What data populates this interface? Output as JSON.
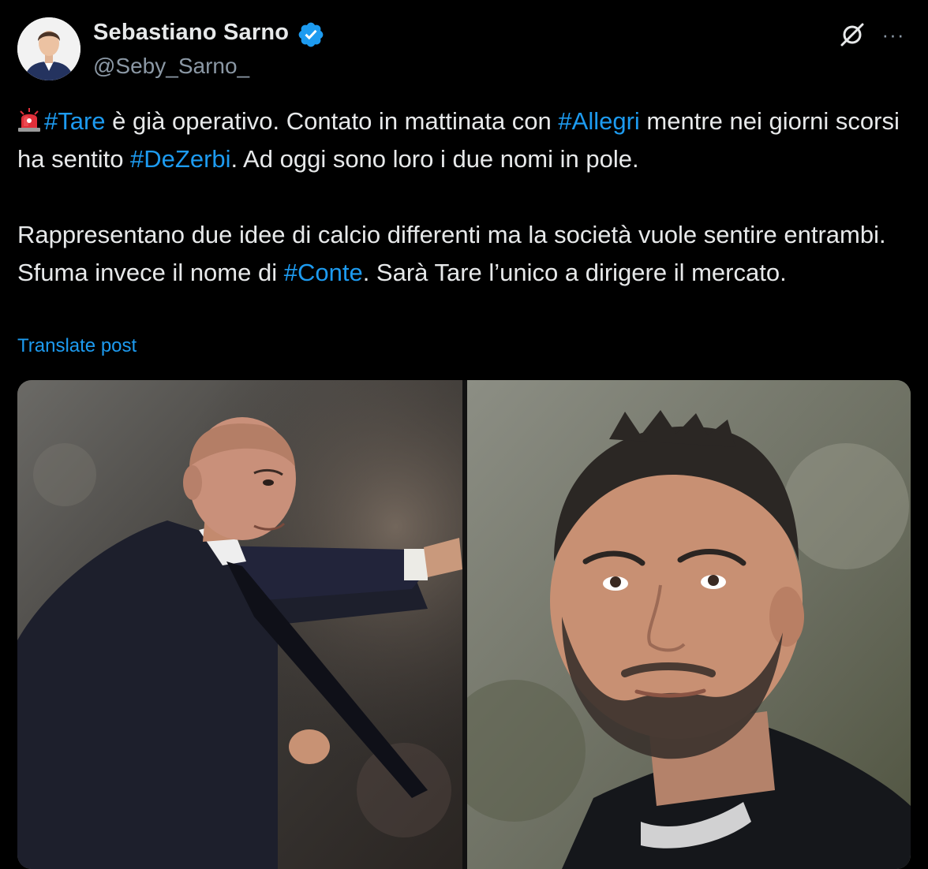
{
  "author": {
    "display_name": "Sebastiano Sarno",
    "handle": "@Seby_Sarno_",
    "verified": true,
    "verified_color": "#1d9bf0"
  },
  "header_actions": {
    "grok_icon": "grok-slash-circle-icon",
    "more_label": "···"
  },
  "post": {
    "siren_icon": "police-siren-emoji",
    "segments_line1": [
      {
        "text": "#Tare",
        "type": "hashtag"
      },
      {
        "text": " è già operativo. Contato in mattinata con ",
        "type": "text"
      },
      {
        "text": "#Allegri",
        "type": "hashtag"
      },
      {
        "text": " mentre nei giorni scorsi ha sentito ",
        "type": "text"
      },
      {
        "text": "#DeZerbi",
        "type": "hashtag"
      },
      {
        "text": ". Ad oggi sono loro i due nomi in pole.",
        "type": "text"
      }
    ],
    "paragraph2": "Rappresentano due idee di calcio differenti ma la società vuole sentire entrambi.",
    "segments_line3": [
      {
        "text": "Sfuma invece il nome di ",
        "type": "text"
      },
      {
        "text": "#Conte",
        "type": "hashtag"
      },
      {
        "text": ". Sarà Tare l’unico a dirigere il mercato.",
        "type": "text"
      }
    ],
    "translate_label": "Translate post"
  },
  "media": {
    "images": [
      {
        "name": "left-photo",
        "subject": "coach-pointing"
      },
      {
        "name": "right-photo",
        "subject": "coach-bearded-closeup"
      }
    ]
  },
  "colors": {
    "background": "#000000",
    "text": "#e7e9ea",
    "secondary": "#8b98a5",
    "link": "#1d9bf0"
  }
}
